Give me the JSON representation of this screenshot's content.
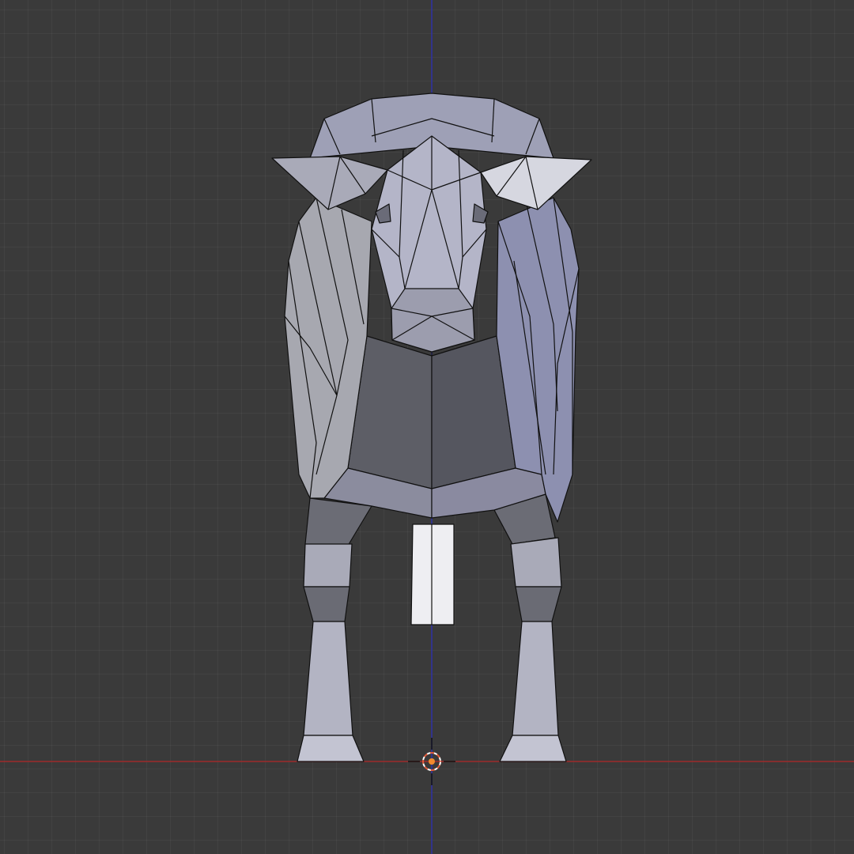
{
  "viewport": {
    "background_color": "#3a3a3a",
    "grid_color": "#444444",
    "axes": {
      "x_axis_color": "#9e2b2b",
      "z_axis_color": "#2c2fa3"
    },
    "model": {
      "subject": "low-poly ox",
      "shading": "flat",
      "base_color": "#b9bbcf",
      "edge_color": "#111111"
    },
    "cursor": {
      "icon": "3d-cursor-icon",
      "colors": [
        "#e05a3a",
        "#ffffff"
      ]
    }
  }
}
